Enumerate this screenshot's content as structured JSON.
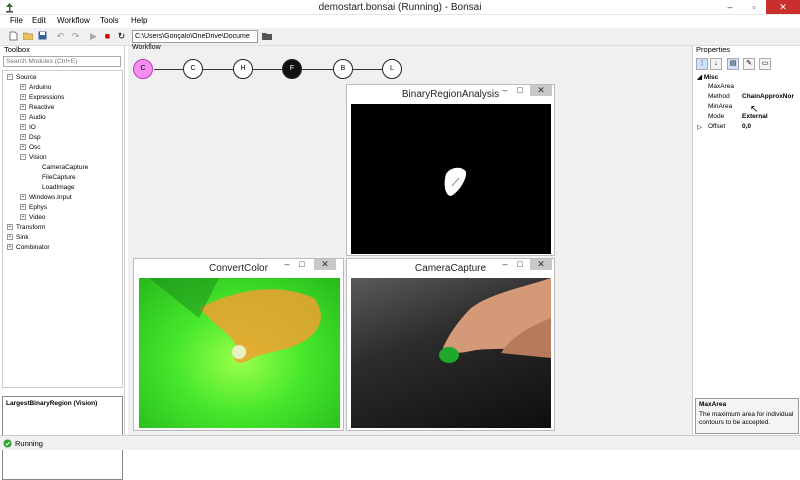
{
  "window": {
    "title": "demostart.bonsai (Running) - Bonsai",
    "min": "–",
    "max": "▫",
    "close": "✕"
  },
  "menu": [
    "File",
    "Edit",
    "Workflow",
    "Tools",
    "Help"
  ],
  "toolbar": {
    "path": "C:\\Users\\Gonçalo\\OneDrive\\Docume"
  },
  "toolbox": {
    "title": "Toolbox",
    "search_placeholder": "Search Modules (Ctrl+E)",
    "tree": [
      {
        "label": "Source",
        "exp": "−"
      },
      {
        "label": "Arduino",
        "exp": "+"
      },
      {
        "label": "Expressions",
        "exp": "+"
      },
      {
        "label": "Reactive",
        "exp": "+"
      },
      {
        "label": "Audio",
        "exp": "+"
      },
      {
        "label": "IO",
        "exp": "+"
      },
      {
        "label": "Dsp",
        "exp": "+"
      },
      {
        "label": "Osc",
        "exp": "+"
      },
      {
        "label": "Vision",
        "exp": "−"
      },
      {
        "label": "CameraCapture",
        "exp": ""
      },
      {
        "label": "FileCapture",
        "exp": ""
      },
      {
        "label": "LoadImage",
        "exp": ""
      },
      {
        "label": "Windows.Input",
        "exp": "+"
      },
      {
        "label": "Ephys",
        "exp": "+"
      },
      {
        "label": "Video",
        "exp": "+"
      },
      {
        "label": "Transform",
        "exp": "+"
      },
      {
        "label": "Sink",
        "exp": "+"
      },
      {
        "label": "Combinator",
        "exp": "+"
      }
    ],
    "description": "LargestBinaryRegion (Vision)"
  },
  "workflow": {
    "title": "Workflow",
    "nodes": [
      {
        "label": "C",
        "style": "pink"
      },
      {
        "label": "C",
        "style": "white"
      },
      {
        "label": "H",
        "style": "white"
      },
      {
        "label": "F",
        "style": "black"
      },
      {
        "label": "B",
        "style": "white"
      },
      {
        "label": "L",
        "style": "white"
      }
    ]
  },
  "visualizers": {
    "binary": {
      "title": "BinaryRegionAnalysis"
    },
    "convert": {
      "title": "ConvertColor"
    },
    "camera": {
      "title": "CameraCapture"
    },
    "min": "–",
    "max": "□",
    "close": "✕"
  },
  "properties": {
    "title": "Properties",
    "category": "Misc",
    "rows": [
      {
        "name": "MaxArea",
        "value": ""
      },
      {
        "name": "Method",
        "value": "ChainApproxNor"
      },
      {
        "name": "MinArea",
        "value": ""
      },
      {
        "name": "Mode",
        "value": "External"
      },
      {
        "name": "Offset",
        "value": "0,0"
      }
    ],
    "desc_title": "MaxArea",
    "desc_text": "The maximum area for individual contours to be accepted."
  },
  "status": {
    "text": "Running"
  },
  "colors": {
    "accent_pink": "#f58ff0",
    "status_green": "#2e9e2e",
    "close_red": "#c9302c"
  }
}
